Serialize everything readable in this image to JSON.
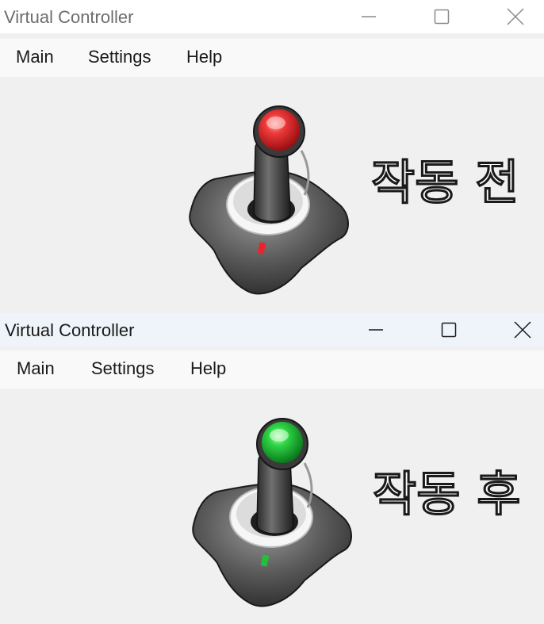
{
  "windows": [
    {
      "title": "Virtual Controller",
      "menu": [
        "Main",
        "Settings",
        "Help"
      ],
      "status_label": "작동 전",
      "indicator_color": "#e8242c",
      "state": "inactive"
    },
    {
      "title": "Virtual Controller",
      "menu": [
        "Main",
        "Settings",
        "Help"
      ],
      "status_label": "작동 후",
      "indicator_color": "#22c03a",
      "state": "active"
    }
  ],
  "icons": {
    "minimize": "minimize-icon",
    "maximize": "maximize-icon",
    "close": "close-icon",
    "joystick": "joystick-icon"
  }
}
